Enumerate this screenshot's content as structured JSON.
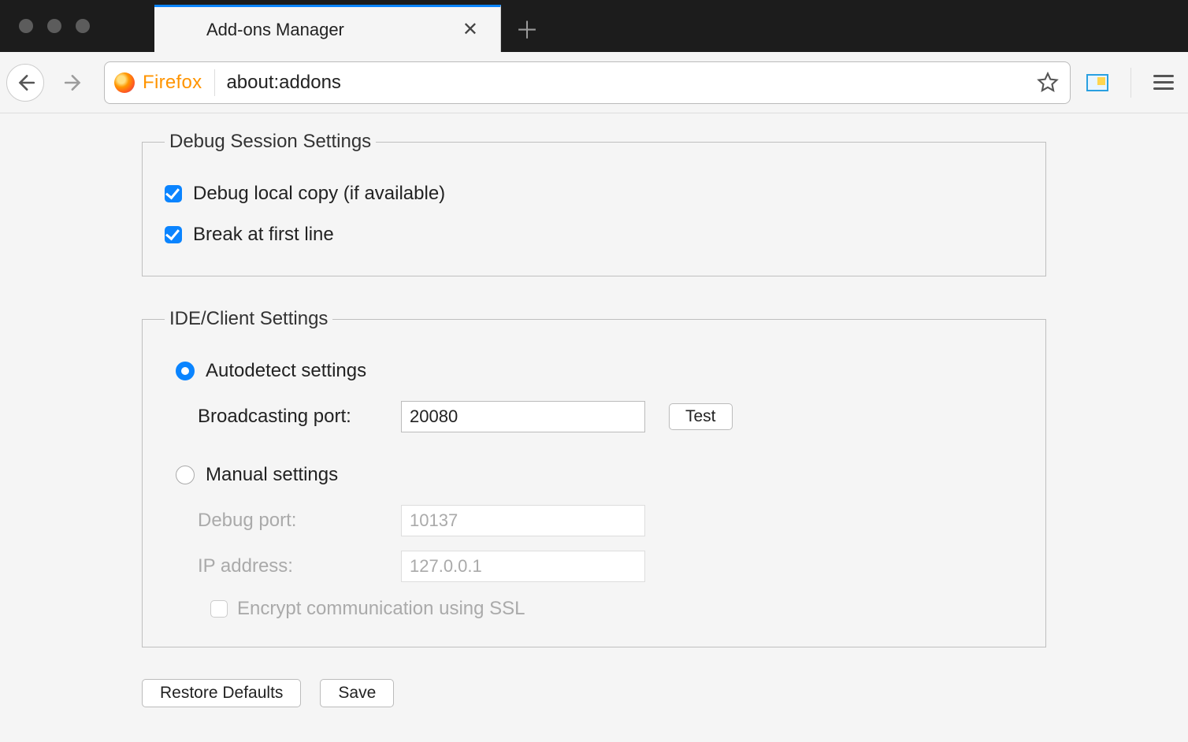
{
  "tab": {
    "title": "Add-ons Manager"
  },
  "url": {
    "identity": "Firefox",
    "value": "about:addons"
  },
  "debug_session": {
    "legend": "Debug Session Settings",
    "local_copy_label": "Debug local copy (if available)",
    "local_copy_checked": true,
    "break_first_label": "Break at first line",
    "break_first_checked": true
  },
  "ide_client": {
    "legend": "IDE/Client Settings",
    "autodetect_label": "Autodetect settings",
    "autodetect_selected": true,
    "broadcasting_port_label": "Broadcasting port:",
    "broadcasting_port_value": "20080",
    "test_label": "Test",
    "manual_label": "Manual settings",
    "manual_selected": false,
    "debug_port_label": "Debug port:",
    "debug_port_value": "10137",
    "ip_label": "IP address:",
    "ip_value": "127.0.0.1",
    "ssl_label": "Encrypt communication using SSL",
    "ssl_checked": false
  },
  "buttons": {
    "restore": "Restore Defaults",
    "save": "Save"
  }
}
